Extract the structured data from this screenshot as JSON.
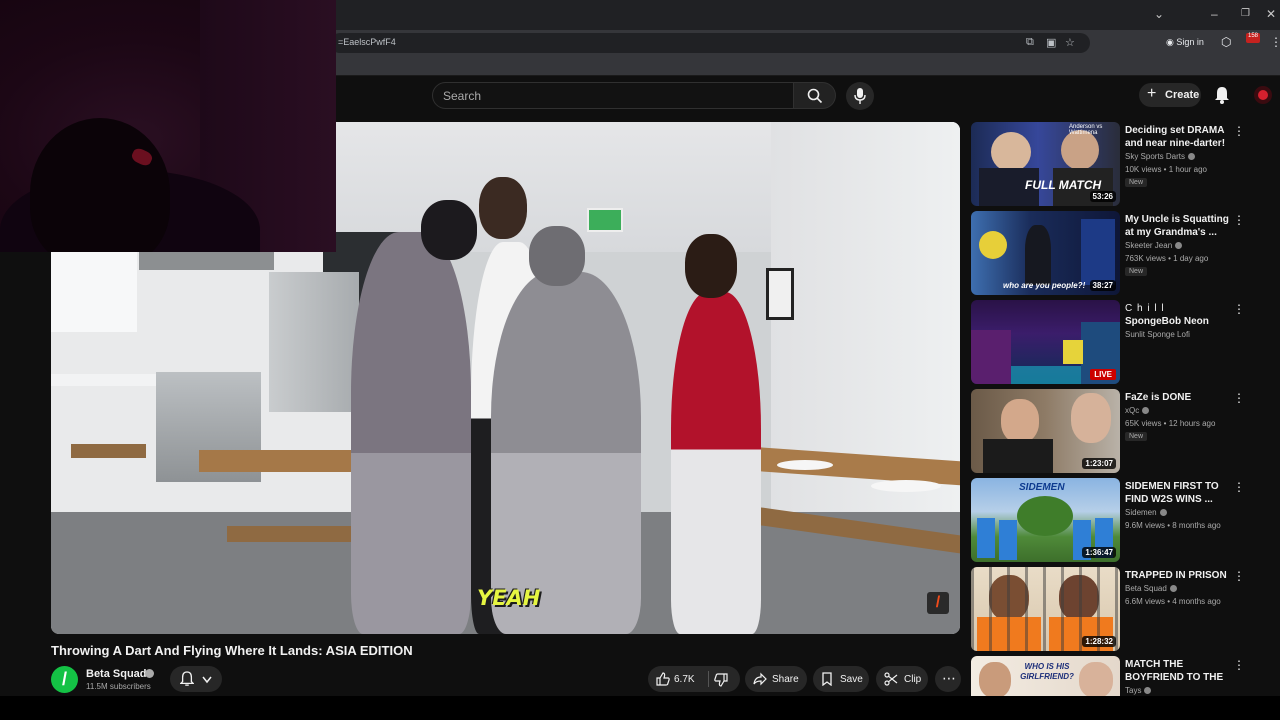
{
  "browser": {
    "url_fragment": "=EaelscPwfF4",
    "sign_in_label": "Sign in",
    "extension_badge": "158"
  },
  "header": {
    "search_placeholder": "Search",
    "create_label": "Create"
  },
  "player": {
    "caption": "YEAH",
    "watermark": "/"
  },
  "video": {
    "title": "Throwing A Dart And Flying Where It Lands: ASIA EDITION",
    "channel": "Beta Squad",
    "channel_initial": "/",
    "subscribers": "11.5M subscribers",
    "likes": "6.7K",
    "share_label": "Share",
    "save_label": "Save",
    "clip_label": "Clip"
  },
  "sidebar": {
    "items": [
      {
        "title": "Deciding set DRAMA and near nine-darter! |...",
        "channel": "Sky Sports Darts",
        "meta": "10K views • 1 hour ago",
        "badge": "New",
        "duration": "53:26",
        "thumb_text": "FULL MATCH",
        "thumb_sub": "Anderson vs Wattimena"
      },
      {
        "title": "My Uncle is Squatting at my Grandma's ...",
        "channel": "Skeeter Jean",
        "meta": "763K views • 1 day ago",
        "badge": "New",
        "duration": "38:27",
        "thumb_text": "who are you people?!"
      },
      {
        "title": "SpongeBob Neon Can...",
        "pretitle": "C h i l l",
        "channel": "Sunlit Sponge Lofi",
        "meta": "",
        "badge": "",
        "duration": "LIVE"
      },
      {
        "title": "FaZe is DONE",
        "channel": "xQc",
        "meta": "65K views • 12 hours ago",
        "badge": "New",
        "duration": "1:23:07"
      },
      {
        "title": "SIDEMEN FIRST TO FIND W2S WINS ...",
        "channel": "Sidemen",
        "meta": "9.6M views • 8 months ago",
        "badge": "",
        "duration": "1:36:47",
        "thumb_text": "SIDEMEN"
      },
      {
        "title": "TRAPPED IN PRISON",
        "channel": "Beta Squad",
        "meta": "6.6M views • 4 months ago",
        "badge": "",
        "duration": "1:28:32"
      },
      {
        "title": "MATCH THE BOYFRIEND TO THE ...",
        "channel": "Tays",
        "meta": "",
        "badge": "",
        "duration": "",
        "thumb_text": "WHO IS HIS GIRLFRIEND?"
      }
    ]
  },
  "colors": {
    "background": "#0f0f0f",
    "caption": "#e6f542",
    "live": "#cc0000",
    "channel_avatar": "#14c245"
  }
}
